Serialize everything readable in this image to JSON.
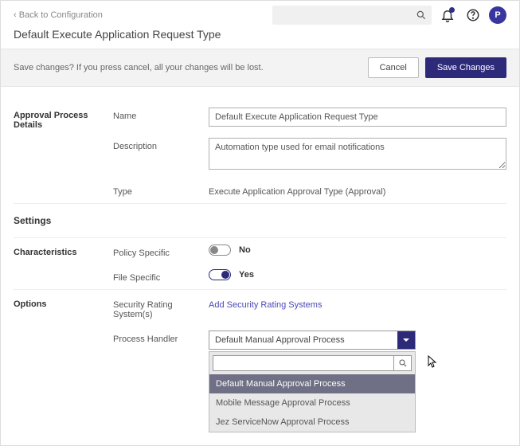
{
  "header": {
    "back_text": "Back to Configuration",
    "avatar_initial": "P"
  },
  "page_title": "Default Execute Application Request Type",
  "save_bar": {
    "message": "Save changes? If you press cancel, all your changes will be lost.",
    "cancel": "Cancel",
    "save": "Save Changes"
  },
  "sections": {
    "approval": {
      "heading": "Approval Process Details",
      "name_label": "Name",
      "name_value": "Default Execute Application Request Type",
      "desc_label": "Description",
      "desc_value": "Automation type used for email notifications",
      "type_label": "Type",
      "type_value": "Execute Application Approval Type (Approval)"
    },
    "settings_heading": "Settings",
    "characteristics": {
      "heading": "Characteristics",
      "policy_label": "Policy Specific",
      "policy_value": "No",
      "file_label": "File Specific",
      "file_value": "Yes"
    },
    "options": {
      "heading": "Options",
      "rating_label": "Security Rating System(s)",
      "rating_link": "Add Security Rating Systems",
      "handler_label": "Process Handler",
      "handler_selected": "Default Manual Approval Process",
      "dropdown": {
        "opt1": "Default Manual Approval Process",
        "opt2": "Mobile Message Approval Process",
        "opt3": "Jez ServiceNow Approval Process"
      }
    }
  }
}
